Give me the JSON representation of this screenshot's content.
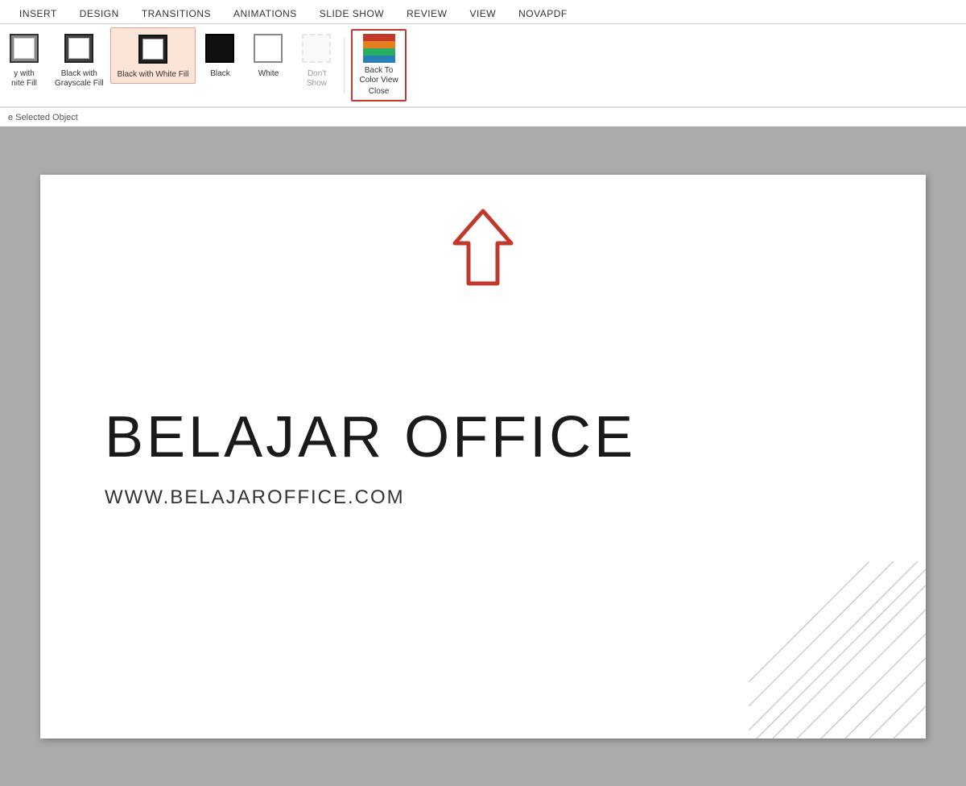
{
  "tabs": {
    "items": [
      {
        "label": "INSERT"
      },
      {
        "label": "DESIGN"
      },
      {
        "label": "TRANSITIONS"
      },
      {
        "label": "ANIMATIONS"
      },
      {
        "label": "SLIDE SHOW"
      },
      {
        "label": "REVIEW"
      },
      {
        "label": "VIEW"
      },
      {
        "label": "novaPDF"
      }
    ]
  },
  "ribbon": {
    "buttons": [
      {
        "id": "gray-with-white",
        "label": "y with\nnite Fill",
        "active": false
      },
      {
        "id": "black-grayscale",
        "label": "Black with\nGrayscale Fill",
        "active": false
      },
      {
        "id": "black-white-fill",
        "label": "Black with\nWhite Fill",
        "active": true
      },
      {
        "id": "black",
        "label": "Black",
        "active": false
      },
      {
        "id": "white",
        "label": "White",
        "active": false
      },
      {
        "id": "dont-show",
        "label": "Don't\nShow",
        "active": false
      }
    ],
    "back_color_view": {
      "label_line1": "Back To",
      "label_line2": "Color View",
      "label_line3": "Close"
    }
  },
  "bottom_bar": {
    "text": "e Selected Object"
  },
  "slide": {
    "title": "BELAJAR OFFICE",
    "subtitle": "WWW.BELAJAROFFICE.COM"
  },
  "colors": {
    "accent_red": "#c0392b",
    "selected_bg": "#fce4d6",
    "selected_border": "#e8a090"
  }
}
